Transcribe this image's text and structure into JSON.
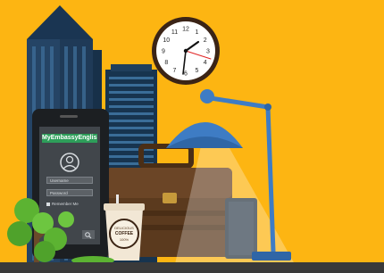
{
  "phone": {
    "app_name": "MyEmbassyEnglish",
    "username_placeholder": "Username",
    "password_placeholder": "Password",
    "remember_label": "Remember Me"
  },
  "coffee_cup": {
    "label_top": "DELICIOUS",
    "label": "COFFEE",
    "label_bottom": "100%"
  },
  "clock": {
    "numerals": [
      "12",
      "1",
      "2",
      "3",
      "4",
      "5",
      "6",
      "7",
      "8",
      "9",
      "10",
      "11"
    ],
    "time": "10:07"
  },
  "colors": {
    "background": "#FDB512",
    "building": "#1F3A57",
    "lamp": "#3E7CC4",
    "bag": "#5B3A1E",
    "tree": "#5CB332",
    "brand_bar": "#2E9E5A"
  }
}
